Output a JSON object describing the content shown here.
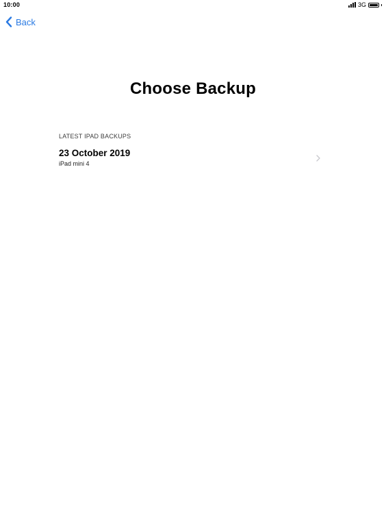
{
  "status_bar": {
    "time": "10:00",
    "network": "3G"
  },
  "nav": {
    "back_label": "Back"
  },
  "page": {
    "title": "Choose Backup"
  },
  "backups": {
    "section_header": "LATEST IPAD BACKUPS",
    "items": [
      {
        "date": "23 October 2019",
        "device": "iPad mini 4"
      }
    ]
  },
  "colors": {
    "accent": "#2a7ae2",
    "chevron": "#c7c7cc",
    "background": "#ffffff"
  },
  "icons": {
    "back": "chevron-left-icon",
    "row": "chevron-right-icon",
    "signal": "signal-bars-icon",
    "battery": "battery-icon"
  }
}
